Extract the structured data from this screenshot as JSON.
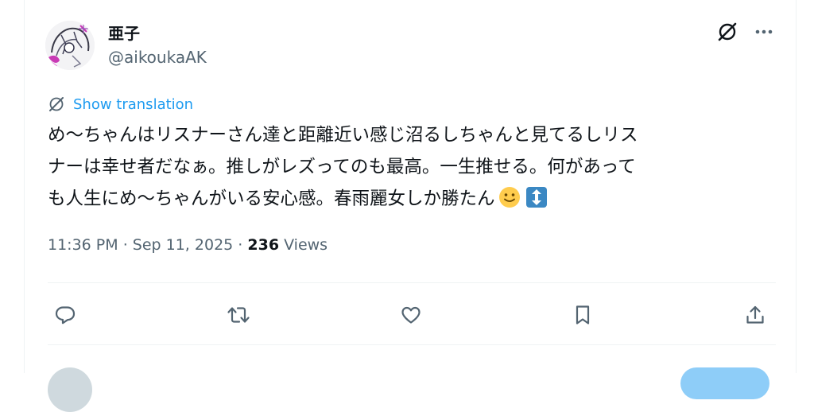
{
  "author": {
    "display_name": "亜子",
    "handle": "@aikoukaAK"
  },
  "header": {
    "grok_icon": "grok-slash-icon",
    "more_icon": "more-dots-icon"
  },
  "translate": {
    "label": "Show translation",
    "icon": "translate-icon"
  },
  "tweet": {
    "lines": [
      "め〜ちゃんはリスナーさん達と距離近い感じ沼るしちゃんと見てるしリス",
      "ナーは幸せ者だなぁ。推しがレズってのも最高。一生推せる。何があって",
      "も人生にめ〜ちゃんがいる安心感。春雨麗女しか勝たん"
    ],
    "emojis": [
      "slightly-smiling-face",
      "up-down-arrow"
    ]
  },
  "meta": {
    "time": "11:36 PM",
    "sep1": " · ",
    "date": "Sep 11, 2025",
    "sep2": " · ",
    "views_count": "236",
    "views_label": " Views"
  },
  "actions": [
    {
      "name": "reply",
      "icon": "reply-icon"
    },
    {
      "name": "retweet",
      "icon": "retweet-icon"
    },
    {
      "name": "like",
      "icon": "heart-icon"
    },
    {
      "name": "bookmark",
      "icon": "bookmark-icon"
    },
    {
      "name": "share",
      "icon": "share-icon"
    }
  ],
  "colors": {
    "link": "#1d9bf0",
    "secondary_text": "#536471",
    "primary_text": "#0f1419",
    "divider": "#eff3f4"
  }
}
